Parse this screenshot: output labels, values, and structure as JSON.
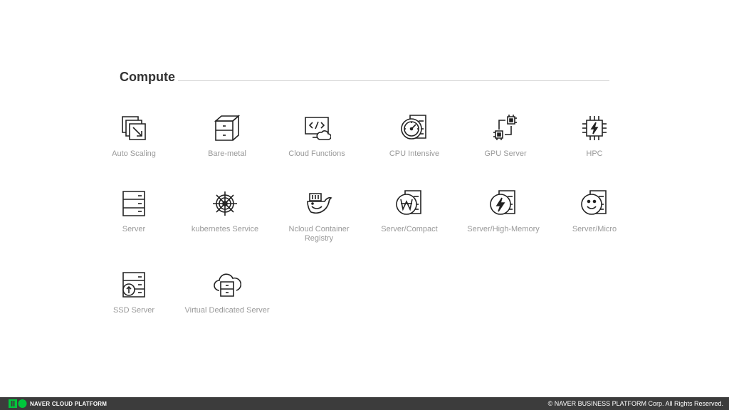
{
  "section": {
    "title": "Compute"
  },
  "services": [
    {
      "label": "Auto Scaling",
      "icon": "auto-scaling-icon"
    },
    {
      "label": "Bare-metal",
      "icon": "bare-metal-icon"
    },
    {
      "label": "Cloud Functions",
      "icon": "cloud-functions-icon"
    },
    {
      "label": "CPU Intensive",
      "icon": "cpu-intensive-icon"
    },
    {
      "label": "GPU Server",
      "icon": "gpu-server-icon"
    },
    {
      "label": "HPC",
      "icon": "hpc-icon"
    },
    {
      "label": "Server",
      "icon": "server-icon"
    },
    {
      "label": "kubernetes Service",
      "icon": "kubernetes-icon"
    },
    {
      "label": "Ncloud Container Registry",
      "icon": "container-registry-icon"
    },
    {
      "label": "Server/Compact",
      "icon": "server-compact-icon"
    },
    {
      "label": "Server/High-Memory",
      "icon": "server-high-memory-icon"
    },
    {
      "label": "Server/Micro",
      "icon": "server-micro-icon"
    },
    {
      "label": "SSD Server",
      "icon": "ssd-server-icon"
    },
    {
      "label": "Virtual Dedicated Server",
      "icon": "virtual-dedicated-server-icon"
    }
  ],
  "footer": {
    "brand": "NAVER CLOUD PLATFORM",
    "copyright": "© NAVER BUSINESS PLATFORM Corp. All Rights Reserved."
  },
  "colors": {
    "title": "#333333",
    "label": "#999999",
    "icon_stroke": "#222222",
    "footer_bg": "#3c3c3c",
    "brand_green": "#00c73c"
  }
}
